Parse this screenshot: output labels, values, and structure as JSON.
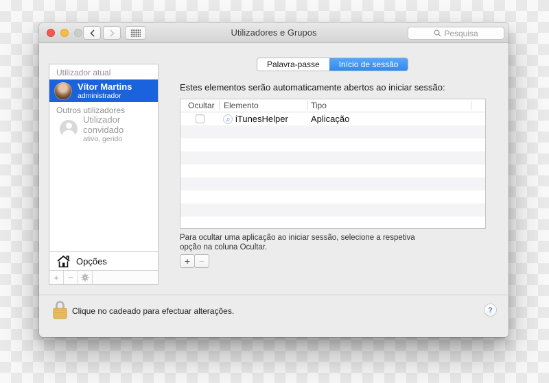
{
  "window": {
    "title": "Utilizadores e Grupos",
    "search_placeholder": "Pesquisa"
  },
  "tabs": [
    {
      "label": "Palavra-passe",
      "selected": false
    },
    {
      "label": "Início de sessão",
      "selected": true
    }
  ],
  "sidebar": {
    "current_user_header": "Utilizador atual",
    "current_user": {
      "name": "Vítor Martins",
      "role": "administrador"
    },
    "other_users_header": "Outros utilizadores",
    "guest_user": {
      "name": "Utilizador convidado",
      "status": "ativo, gerido"
    },
    "options_label": "Opções",
    "toolbar": {
      "add": "+",
      "remove": "−"
    }
  },
  "content": {
    "heading": "Estes elementos serão automaticamente abertos ao iniciar sessão:",
    "table": {
      "columns": [
        "Ocultar",
        "Elemento",
        "Tipo"
      ],
      "rows": [
        {
          "hide_checked": false,
          "element": "iTunesHelper",
          "type": "Aplicação"
        }
      ]
    },
    "note_line1": "Para ocultar uma aplicação ao iniciar sessão, selecione a respetiva",
    "note_line2": "opção na coluna Ocultar.",
    "controls": {
      "add": "+",
      "remove": "−"
    }
  },
  "footer": {
    "lock_text": "Clique no cadeado para efectuar alterações.",
    "help_label": "?"
  },
  "icons": {
    "itunes_note": "♫"
  },
  "colors": {
    "selection_blue": "#1b63dc",
    "tab_blue": "#2f8bf0",
    "lock_gold": "#ecbe63",
    "help_blue": "#3b77f0"
  }
}
